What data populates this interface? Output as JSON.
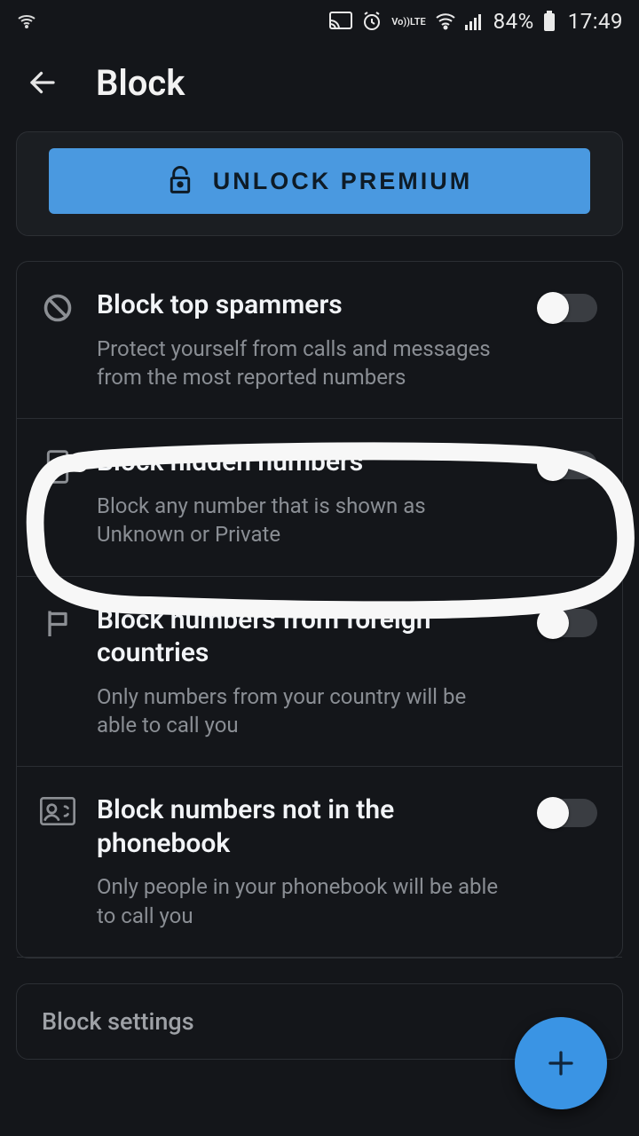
{
  "status": {
    "battery": "84%",
    "time": "17:49",
    "lte": "LTE",
    "vo": "Vo))"
  },
  "header": {
    "title": "Block"
  },
  "premium": {
    "button_label": "UNLOCK PREMIUM"
  },
  "settings": [
    {
      "title": "Block top spammers",
      "desc": "Protect yourself from calls and messages from the most reported numbers",
      "toggle": false
    },
    {
      "title": "Block hidden numbers",
      "desc": "Block any number that is shown as Unknown or Private",
      "toggle": false
    },
    {
      "title": "Block numbers from foreign countries",
      "desc": "Only numbers from your country will be able to call you",
      "toggle": false
    },
    {
      "title": "Block numbers not in the phonebook",
      "desc": "Only people in your phonebook will be able to call you",
      "toggle": false
    }
  ],
  "bottom_section": {
    "title": "Block settings"
  }
}
